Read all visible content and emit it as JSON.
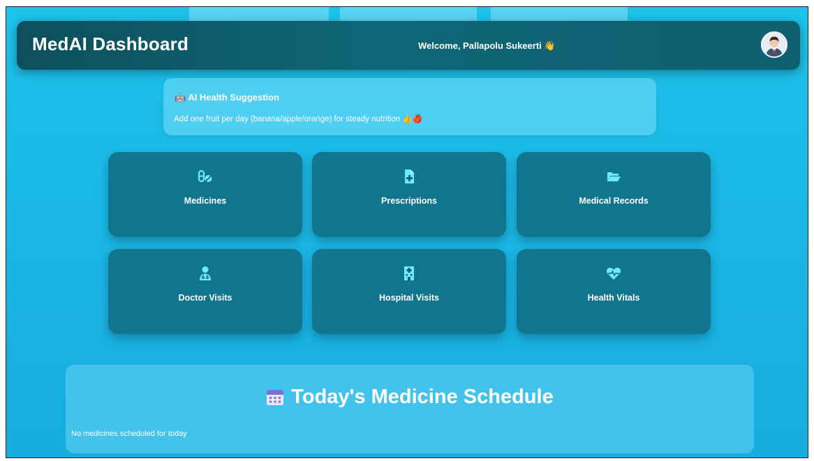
{
  "header": {
    "title": "MedAI Dashboard",
    "welcome": "Welcome, Pallapolu Sukeerti 👋",
    "avatar_icon": "user-avatar-icon"
  },
  "suggestion": {
    "title": "🤖 AI Health Suggestion",
    "text": "Add one fruit per day (banana/apple/orange) for steady nutrition 👍🍎"
  },
  "cards": [
    {
      "label": "Medicines",
      "icon": "pills-icon",
      "sub": ""
    },
    {
      "label": "Prescriptions",
      "icon": "file-medical-icon",
      "sub": ""
    },
    {
      "label": "Medical Records",
      "icon": "folder-open-icon",
      "sub": ""
    },
    {
      "label": "Doctor Visits",
      "icon": "doctor-icon",
      "sub": ""
    },
    {
      "label": "Hospital Visits",
      "icon": "hospital-icon",
      "sub": ""
    },
    {
      "label": "Health Vitals",
      "icon": "heart-pulse-icon",
      "sub": ""
    }
  ],
  "schedule": {
    "title": "Today's Medicine Schedule",
    "empty_text": "No medicines scheduled for today"
  },
  "colors": {
    "background": "#1ab8e6",
    "header": "#0f6676",
    "card": "#0e6476"
  }
}
